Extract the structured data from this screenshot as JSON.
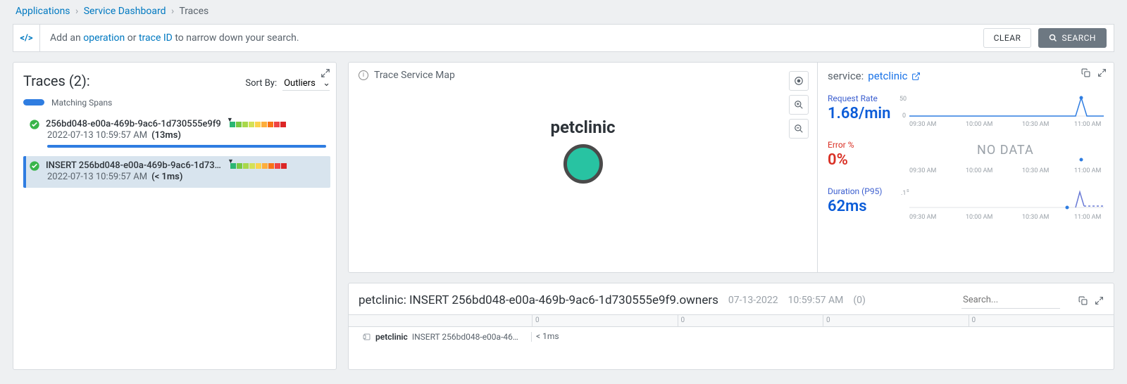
{
  "breadcrumb": {
    "items": [
      "Applications",
      "Service Dashboard"
    ],
    "current": "Traces"
  },
  "searchbar": {
    "icon_label": "</>",
    "hint_pre": "Add an ",
    "hint_op": "operation",
    "hint_mid": " or ",
    "hint_tid": "trace ID",
    "hint_post": " to narrow down your search.",
    "clear": "CLEAR",
    "search": "SEARCH"
  },
  "left": {
    "title": "Traces (2):",
    "sort_label": "Sort By:",
    "sort_value": "Outliers",
    "legend": "Matching Spans",
    "traces": [
      {
        "id": "256bd048-e00a-469b-9ac6-1d730555e9f9",
        "ts": "2022-07-13 10:59:57 AM",
        "dur": "(13ms)"
      },
      {
        "id": "INSERT 256bd048-e00a-469b-9ac6-1d730…",
        "ts": "2022-07-13 10:59:57 AM",
        "dur": "(< 1ms)"
      }
    ]
  },
  "map": {
    "title": "Trace Service Map",
    "node": "petclinic"
  },
  "stats": {
    "label": "service:",
    "service": "petclinic",
    "rows": [
      {
        "cap": "Request Rate",
        "val": "1.68/min",
        "color": "blue"
      },
      {
        "cap": "Error %",
        "val": "0%",
        "color": "red",
        "nodata": "NO DATA"
      },
      {
        "cap": "Duration (P95)",
        "val": "62ms",
        "color": "blue"
      }
    ],
    "ticks": [
      "09:30 AM",
      "10:00 AM",
      "10:30 AM",
      "11:00 AM"
    ]
  },
  "timeline": {
    "title": "petclinic: INSERT 256bd048-e00a-469b-9ac6-1d730555e9f9.owners",
    "date": "07-13-2022",
    "time": "10:59:57 AM",
    "count": "(0)",
    "search_ph": "Search...",
    "ruler": [
      "",
      "0",
      "0",
      "0",
      "0"
    ],
    "row": {
      "svc": "petclinic",
      "op": "INSERT 256bd048-e00a-46…",
      "dur": "< 1ms"
    }
  },
  "chart_data": [
    {
      "type": "line",
      "title": "Request Rate",
      "ylabel": "",
      "ylim": [
        0,
        50
      ],
      "ticks": [
        0,
        50
      ],
      "categories": [
        "09:30 AM",
        "10:00 AM",
        "10:30 AM",
        "11:00 AM"
      ],
      "values": [
        0,
        0,
        0,
        48
      ]
    },
    {
      "type": "line",
      "title": "Error %",
      "nodata": true,
      "categories": [
        "09:30 AM",
        "10:00 AM",
        "10:30 AM",
        "11:00 AM"
      ],
      "values": []
    },
    {
      "type": "line",
      "title": "Duration (P95)",
      "ylabel": "s",
      "ylim": [
        0,
        0.1
      ],
      "ticks": [
        0.1
      ],
      "categories": [
        "09:30 AM",
        "10:00 AM",
        "10:30 AM",
        "11:00 AM"
      ],
      "values": [
        0,
        0,
        0,
        0.095
      ]
    }
  ]
}
